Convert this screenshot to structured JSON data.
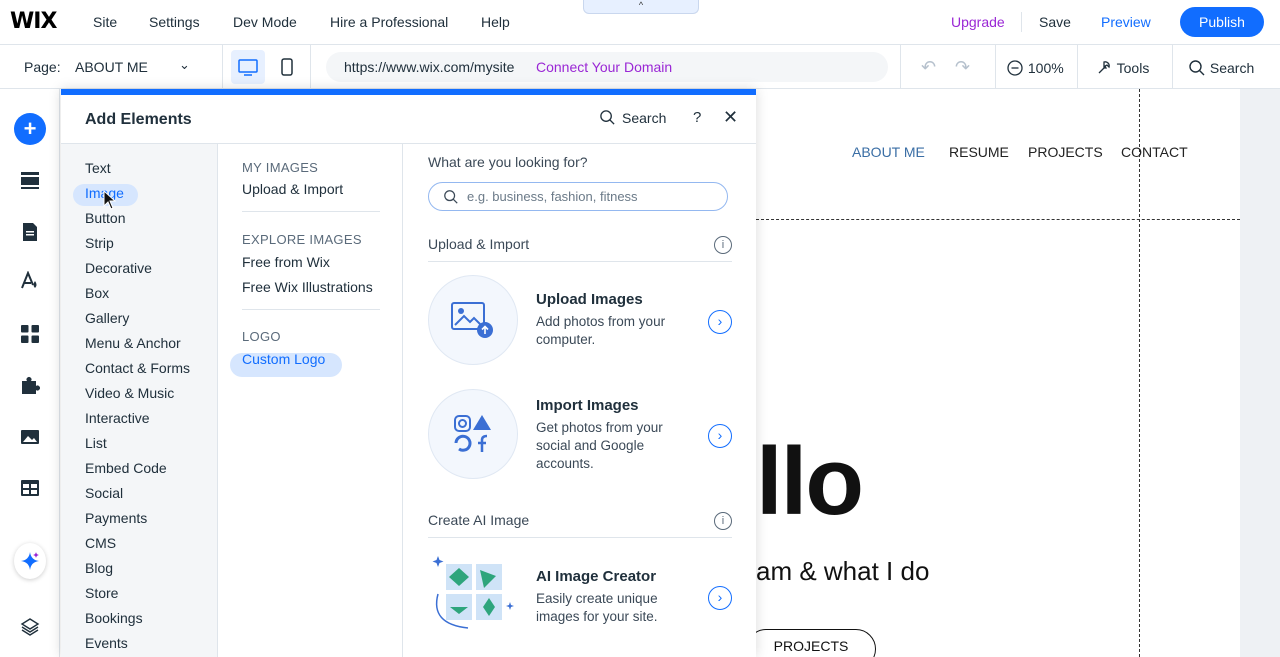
{
  "topbar": {
    "logo": "WIX",
    "menu": [
      "Site",
      "Settings",
      "Dev Mode",
      "Hire a Professional",
      "Help"
    ],
    "notch": "^",
    "upgrade": "Upgrade",
    "save": "Save",
    "preview": "Preview",
    "publish": "Publish"
  },
  "toolbar": {
    "page_label": "Page:",
    "page_name": "ABOUT ME",
    "url": "https://www.wix.com/mysite",
    "connect": "Connect Your Domain",
    "zoom": "100%",
    "tools": "Tools",
    "search": "Search"
  },
  "panel": {
    "title": "Add Elements",
    "search": "Search",
    "help": "?",
    "close": "✕",
    "categories": [
      "Text",
      "Image",
      "Button",
      "Strip",
      "Decorative",
      "Box",
      "Gallery",
      "Menu & Anchor",
      "Contact & Forms",
      "Video & Music",
      "Interactive",
      "List",
      "Embed Code",
      "Social",
      "Payments",
      "CMS",
      "Blog",
      "Store",
      "Bookings",
      "Events"
    ],
    "selected_category": "Image",
    "sections": {
      "my_images": "MY IMAGES",
      "upload_import": "Upload & Import",
      "explore_images": "EXPLORE IMAGES",
      "free_from_wix": "Free from Wix",
      "free_illustrations": "Free Wix Illustrations",
      "logo": "LOGO",
      "custom_logo": "Custom Logo"
    },
    "content": {
      "question": "What are you looking for?",
      "placeholder": "e.g. business, fashion, fitness",
      "group1": "Upload & Import",
      "group2": "Create AI Image",
      "cards": [
        {
          "title": "Upload Images",
          "desc": "Add photos from your computer."
        },
        {
          "title": "Import Images",
          "desc": "Get photos from your social and Google accounts."
        },
        {
          "title": "AI Image Creator",
          "desc": "Easily create unique images for your site."
        }
      ]
    }
  },
  "canvas": {
    "nav": [
      "ABOUT ME",
      "RESUME",
      "PROJECTS",
      "CONTACT"
    ],
    "hero": "llo",
    "tagline": "am & what I do",
    "button": "PROJECTS"
  },
  "colors": {
    "accent": "#116dff",
    "upgrade": "#9a27d5",
    "selected_bg": "#d6e6fe"
  }
}
